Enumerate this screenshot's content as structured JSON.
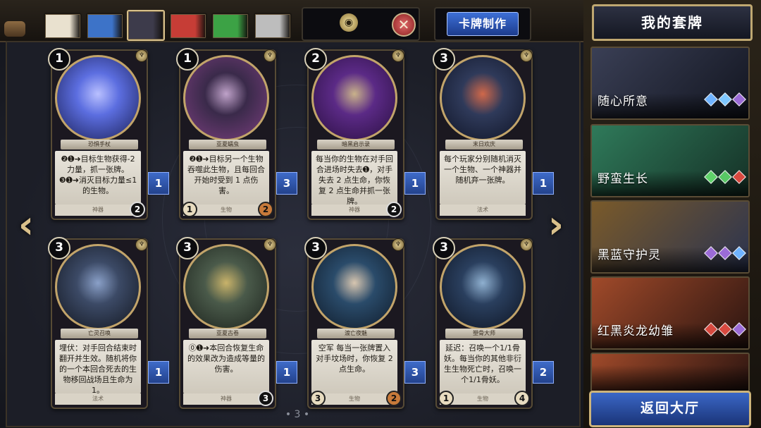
{
  "header": {
    "craft_label": "卡牌制作",
    "close_symbol": "✕",
    "filter_icon": "eye-icon"
  },
  "color_tabs": [
    {
      "color": "#e9e1cf",
      "name": "white"
    },
    {
      "color": "#3d73c8",
      "name": "blue"
    },
    {
      "color": "#3d3b4b",
      "name": "black",
      "selected": true
    },
    {
      "color": "#c63d36",
      "name": "red"
    },
    {
      "color": "#3ca245",
      "name": "green"
    },
    {
      "color": "#bdbdbd",
      "name": "colorless"
    }
  ],
  "cards": [
    {
      "cost": "1",
      "name": "恐惧手杖",
      "text": "❷➊➜目标生物获得-2力量，抓一张牌。❸➊➜消灭目标力量≤1的生物。",
      "type": "神器",
      "atk": "",
      "hp": "2",
      "hp_style": "dark",
      "count": "1",
      "art": [
        "#5c6ee0",
        "#1a1f55",
        "#b9c0ff"
      ]
    },
    {
      "cost": "1",
      "name": "亚夏蠕虫",
      "text": "❷➊➜目标另一个生物吞噬此生物，且每回合开始时受到 1 点伤害。",
      "type": "生物",
      "atk": "1",
      "hp": "2",
      "hp_style": "red",
      "count": "3",
      "art": [
        "#3a2a4a",
        "#7a3e7e",
        "#bfa2c9"
      ]
    },
    {
      "cost": "2",
      "name": "暗黑启示录",
      "text": "每当你的生物在对手回合进场时失去➊，对手失去 2 点生命，你恢复 2 点生命并抓一张牌。",
      "type": "神器",
      "atk": "",
      "hp": "2",
      "hp_style": "dark",
      "count": "1",
      "art": [
        "#5b2a86",
        "#2a0f40",
        "#c9b28a"
      ]
    },
    {
      "cost": "3",
      "name": "末日欢庆",
      "text": "每个玩家分别随机消灭一个生物、一个神器并随机弃一张牌。",
      "type": "法术",
      "atk": "",
      "hp": "",
      "hp_style": "",
      "count": "1",
      "art": [
        "#2f3a5a",
        "#0f1426",
        "#d0684a"
      ]
    },
    {
      "cost": "3",
      "name": "亡灵召唤",
      "text": "埋伏：对手回合结束时翻开并生效。随机将你的一个本回合死去的生物移回战场且生命为 1。",
      "type": "法术",
      "atk": "",
      "hp": "",
      "hp_style": "",
      "count": "1",
      "art": [
        "#3c4a66",
        "#12161f",
        "#8aa0c8"
      ]
    },
    {
      "cost": "3",
      "name": "亚夏古卷",
      "text": "⓪➊➜本回合恢复生命的效果改为造成等量的伤害。",
      "type": "神器",
      "atk": "",
      "hp": "3",
      "hp_style": "dark",
      "count": "1",
      "art": [
        "#4a5a4a",
        "#1c221c",
        "#c9b36a"
      ]
    },
    {
      "cost": "3",
      "name": "渡亡夜魅",
      "text": "空军 每当一张牌置入对手坟场时，你恢复 2 点生命。",
      "type": "生物",
      "atk": "3",
      "hp": "2",
      "hp_style": "red",
      "count": "3",
      "art": [
        "#2a4b6a",
        "#0f1a28",
        "#d8c6b0"
      ]
    },
    {
      "cost": "3",
      "name": "塑骨大师",
      "text": "延迟：召唤一个1/1骨妖。每当你的其他非衍生生物死亡时，召唤一个1/1骨妖。",
      "type": "生物",
      "atk": "1",
      "hp": "4",
      "hp_style": "",
      "count": "2",
      "art": [
        "#2a3f5e",
        "#0d1422",
        "#8fb0d0"
      ]
    }
  ],
  "page": {
    "number": "3"
  },
  "right_panel": {
    "title": "我的套牌",
    "decks": [
      {
        "name": "随心所意",
        "gems": [
          "#6fb3ff",
          "#7ec7ff",
          "#9b6bd6"
        ],
        "art": [
          "#3a3f55",
          "#121520"
        ]
      },
      {
        "name": "野蛮生长",
        "gems": [
          "#5fd36a",
          "#58c865",
          "#d8493f"
        ],
        "art": [
          "#2f7a5a",
          "#153026"
        ]
      },
      {
        "name": "黑蓝守护灵",
        "gems": [
          "#9b6bd6",
          "#9b6bd6",
          "#6fb3ff"
        ],
        "art": [
          "#7a5a2a",
          "#2a3350"
        ]
      },
      {
        "name": "红黑炎龙幼雏",
        "gems": [
          "#d8493f",
          "#d8493f",
          "#9b6bd6"
        ],
        "art": [
          "#a04a2a",
          "#2a1410"
        ]
      },
      {
        "name": "",
        "gems": [],
        "art": [
          "#a04a2a",
          "#2a1410"
        ]
      }
    ],
    "back_label": "返回大厅"
  }
}
